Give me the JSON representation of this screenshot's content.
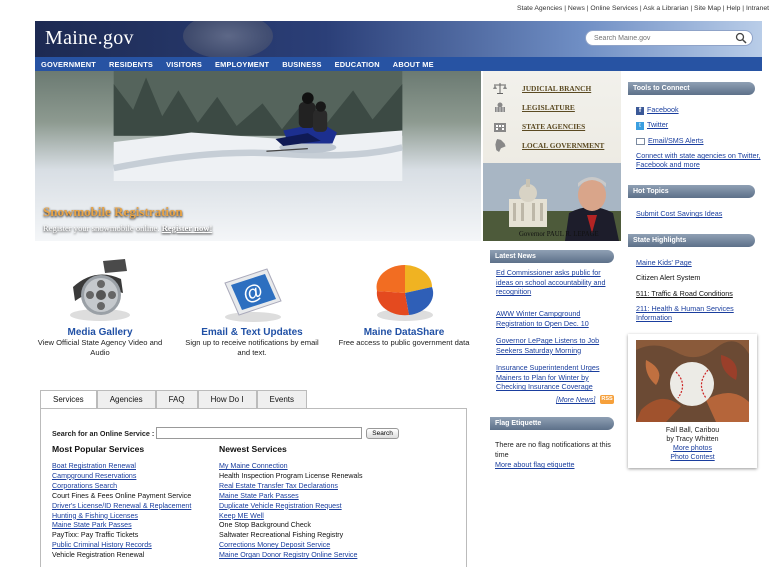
{
  "utility_links": [
    "State Agencies",
    "News",
    "Online Services",
    "Ask a Librarian",
    "Site Map",
    "Help",
    "Intranet"
  ],
  "utility_text": "State Agencies | News | Online Services | Ask a Librarian | Site Map | Help | Intranet",
  "header": {
    "logo": "Maine.gov",
    "search_placeholder": "Search Maine.gov"
  },
  "nav": [
    "GOVERNMENT",
    "RESIDENTS",
    "VISITORS",
    "EMPLOYMENT",
    "BUSINESS",
    "EDUCATION",
    "ABOUT ME"
  ],
  "hero": {
    "title": "Snowmobile Registration",
    "subtitle": "Register your snowmobile online.",
    "link": "Register now!"
  },
  "gov_links": [
    "JUDICIAL BRANCH",
    "LEGISLATURE",
    "STATE AGENCIES",
    "LOCAL GOVERNMENT"
  ],
  "governor_caption": "Governor PAUL R. LEPAGE",
  "tools": {
    "title": "Tools to Connect",
    "facebook": "Facebook",
    "twitter": "Twitter",
    "alerts": "Email/SMS Alerts",
    "connect": "Connect with state agencies on Twitter, Facebook and more"
  },
  "hot_topics": {
    "title": "Hot Topics",
    "items": [
      "Submit Cost Savings Ideas"
    ]
  },
  "highlights": {
    "title": "State Highlights",
    "items": [
      "Maine Kids' Page",
      "Citizen Alert System",
      "511: Traffic & Road Conditions",
      "211: Health & Human Services Information"
    ]
  },
  "latest_news": {
    "title": "Latest News",
    "items": [
      "Ed Commissioner asks public for ideas on school accountability and recognition",
      "AWW Winter Campground Registration to Open Dec. 10",
      "Governor LePage Listens to Job Seekers Saturday Morning",
      "Insurance Superintendent Urges Mainers to Plan for Winter by Checking Insurance Coverage"
    ],
    "more": "[More News]",
    "rss": "RSS"
  },
  "flag": {
    "title": "Flag Etiquette",
    "text": "There are no flag notifications at this time",
    "link": "More about flag etiquette"
  },
  "features": [
    {
      "title": "Media Gallery",
      "desc": "View Official State Agency Video and Audio"
    },
    {
      "title": "Email & Text Updates",
      "desc": "Sign up to receive notifications by email and text."
    },
    {
      "title": "Maine DataShare",
      "desc": "Free access to public government data"
    }
  ],
  "tabs": [
    "Services",
    "Agencies",
    "FAQ",
    "How Do I",
    "Events"
  ],
  "services": {
    "search_label": "Search for an Online Service :",
    "search_button": "Search",
    "popular_title": "Most Popular Services",
    "newest_title": "Newest Services",
    "popular": [
      "Boat Registration Renewal",
      "Campground Reservations",
      "Corporations Search",
      "Court Fines & Fees Online Payment Service",
      "Driver's License/ID Renewal & Replacement",
      "Hunting & Fishing Licenses",
      "Maine State Park Passes",
      "PayTixx: Pay Traffic Tickets",
      "Public Criminal History Records",
      "Vehicle Registration Renewal"
    ],
    "newest": [
      "My Maine Connection",
      "Health Inspection Program License Renewals",
      "Real Estate Transfer Tax Declarations",
      "Maine State Park Passes",
      "Duplicate Vehicle Registration Request",
      "Keep ME Well",
      "One Stop Background Check",
      "Saltwater Recreational Fishing Registry",
      "Corrections Money Deposit Service",
      "Maine Organ Donor Registry Online Service"
    ]
  },
  "photo_contest": {
    "caption1": "Fall Ball, Caribou",
    "caption2": "by Tracy Whitten",
    "more": "More photos",
    "contest": "Photo Contest"
  }
}
